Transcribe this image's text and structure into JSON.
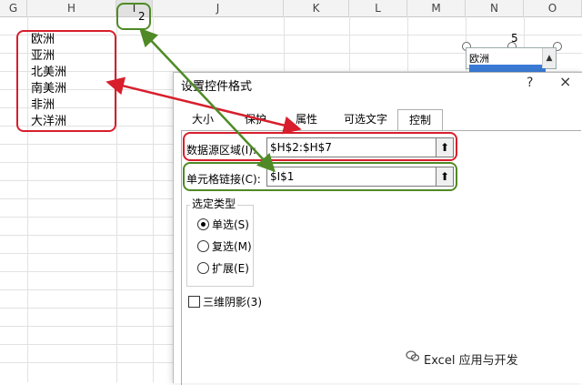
{
  "spreadsheet": {
    "columns": [
      "G",
      "H",
      "I",
      "J",
      "K",
      "L",
      "M",
      "N",
      "O"
    ],
    "selected_column": "I",
    "list_values": [
      "欧洲",
      "亚洲",
      "北美洲",
      "南美洲",
      "非洲",
      "大洋洲"
    ],
    "link_cell_value": "2",
    "control_caption": "5",
    "listbox_first_item": "欧洲"
  },
  "dialog": {
    "title": "设置控件格式",
    "help": "?",
    "close": "×",
    "tabs": [
      "大小",
      "保护",
      "属性",
      "可选文字",
      "控制"
    ],
    "active_tab": "控制",
    "input_range_label": "数据源区域(I):",
    "input_range_value": "$H$2:$H$7",
    "cell_link_label": "单元格链接(C):",
    "cell_link_value": "$I$1",
    "collapse_glyph": "⬆",
    "selection_type_title": "选定类型",
    "options": [
      "单选(S)",
      "复选(M)",
      "扩展(E)"
    ],
    "selected_option": "单选(S)",
    "shading_label": "三维阴影(3)"
  },
  "watermark": {
    "text": "Excel 应用与开发"
  },
  "colors": {
    "red_annotation": "#d81e2c",
    "green_annotation": "#4f8a26",
    "selection_blue": "#3a7bd5"
  }
}
